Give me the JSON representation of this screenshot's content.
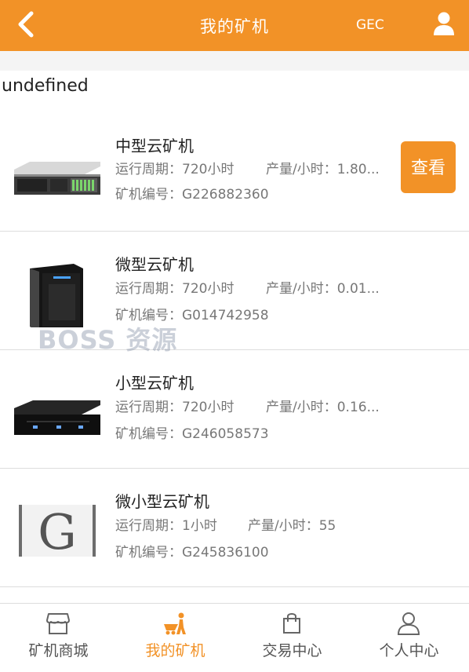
{
  "header": {
    "title": "我的矿机",
    "currency": "GEC",
    "accent": "#f29227"
  },
  "content": {
    "undefined_text": "undefined"
  },
  "items": [
    {
      "name": "中型云矿机",
      "cycle": "运行周期：720小时",
      "output": "产量/小时：1.80...",
      "serial": "矿机编号：G226882360",
      "image": "server-rack",
      "action": "查看"
    },
    {
      "name": "微型云矿机",
      "cycle": "运行周期：720小时",
      "output": "产量/小时：0.01...",
      "serial": "矿机编号：G014742958",
      "image": "tower-case"
    },
    {
      "name": "小型云矿机",
      "cycle": "运行周期：720小时",
      "output": "产量/小时：0.16...",
      "serial": "矿机编号：G246058573",
      "image": "flat-case"
    },
    {
      "name": "微小型云矿机",
      "cycle": "运行周期：1小时",
      "output": "产量/小时：55",
      "serial": "矿机编号：G245836100",
      "image": "g-logo"
    }
  ],
  "watermark": "BOSS 资源",
  "tabs": [
    {
      "label": "矿机商城",
      "icon": "shop-icon"
    },
    {
      "label": "我的矿机",
      "icon": "miner-icon",
      "active": true
    },
    {
      "label": "交易中心",
      "icon": "bag-icon"
    },
    {
      "label": "个人中心",
      "icon": "person-icon"
    }
  ]
}
